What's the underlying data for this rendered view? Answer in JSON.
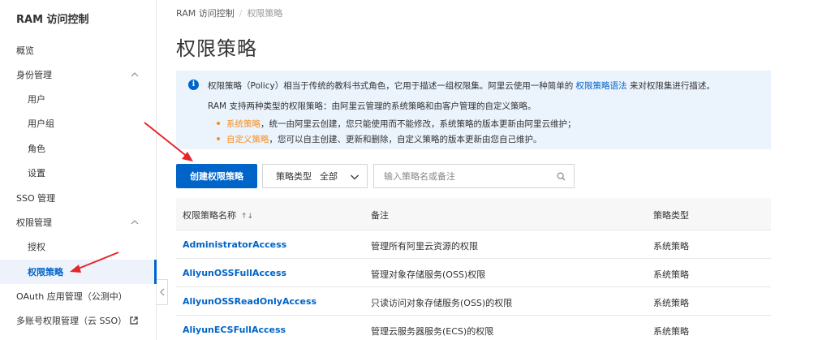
{
  "sidebar": {
    "title": "RAM 访问控制",
    "items": [
      {
        "label": "概览"
      },
      {
        "label": "身份管理"
      },
      {
        "label": "用户"
      },
      {
        "label": "用户组"
      },
      {
        "label": "角色"
      },
      {
        "label": "设置"
      },
      {
        "label": "SSO 管理"
      },
      {
        "label": "权限管理"
      },
      {
        "label": "授权"
      },
      {
        "label": "权限策略"
      },
      {
        "label": "OAuth 应用管理（公测中）"
      },
      {
        "label": "多账号权限管理（云 SSO）"
      }
    ],
    "active_item": "权限策略"
  },
  "breadcrumb": {
    "root": "RAM 访问控制",
    "separator": "/",
    "current": "权限策略"
  },
  "page": {
    "title": "权限策略"
  },
  "notice": {
    "line1_before": "权限策略（Policy）相当于传统的教科书式角色，它用于描述一组权限集。阿里云使用一种简单的 ",
    "line1_link": "权限策略语法",
    "line1_after": " 来对权限集进行描述。",
    "line2": "RAM 支持两种类型的权限策略：由阿里云管理的系统策略和由客户管理的自定义策略。",
    "bullet1_label": "系统策略",
    "bullet1_text": "，统一由阿里云创建，您只能使用而不能修改，系统策略的版本更新由阿里云维护；",
    "bullet2_label": "自定义策略",
    "bullet2_text": "，您可以自主创建、更新和删除，自定义策略的版本更新由您自己维护。"
  },
  "toolbar": {
    "create_label": "创建权限策略",
    "type_label": "策略类型",
    "type_value": "全部",
    "search_placeholder": "输入策略名或备注"
  },
  "table": {
    "columns": [
      "权限策略名称",
      "备注",
      "策略类型"
    ],
    "rows": [
      [
        "AdministratorAccess",
        "管理所有阿里云资源的权限",
        "系统策略"
      ],
      [
        "AliyunOSSFullAccess",
        "管理对象存储服务(OSS)权限",
        "系统策略"
      ],
      [
        "AliyunOSSReadOnlyAccess",
        "只读访问对象存储服务(OSS)的权限",
        "系统策略"
      ],
      [
        "AliyunECSFullAccess",
        "管理云服务器服务(ECS)的权限",
        "系统策略"
      ]
    ]
  },
  "colors": {
    "accent": "#0064c8",
    "orange": "#f98e1d",
    "notice_bg": "#ebf3fd",
    "annotation": "#e5262a"
  }
}
